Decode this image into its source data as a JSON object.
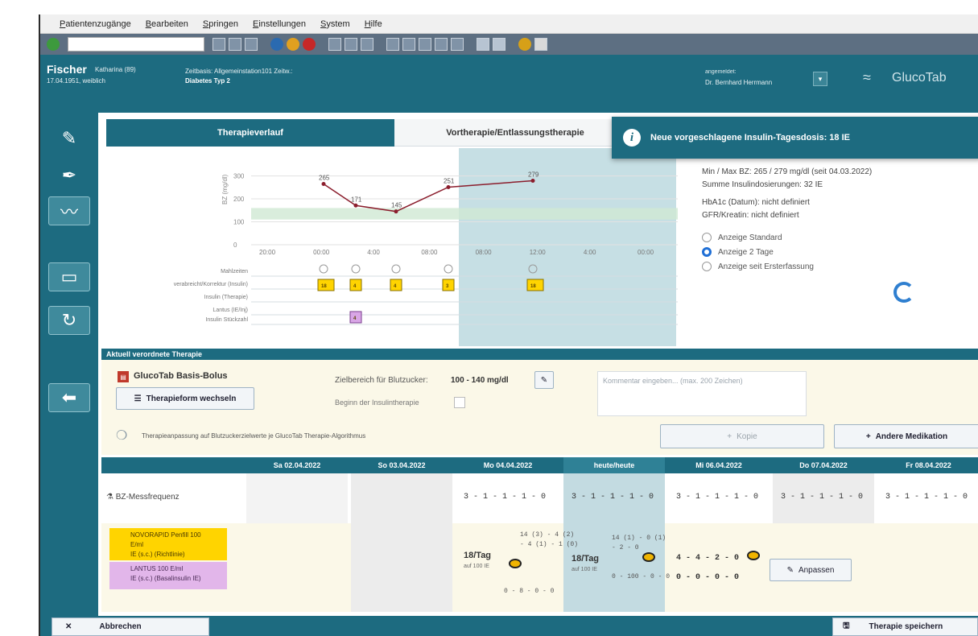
{
  "menu": [
    "Patientenzugänge",
    "Bearbeiten",
    "Springen",
    "Einstellungen",
    "System",
    "Hilfe"
  ],
  "toolbar": {
    "address_value": ""
  },
  "header": {
    "patient_name": "Fischer",
    "patient_first": "Katharina (89)",
    "patient_date": "17.04.1951, weiblich",
    "patient_info": "Zeitbasis: Allgemeinstation101 Zeitw.:",
    "diagnosis": "Diabetes Typ 2",
    "login_label": "angemeldet:",
    "login_user": "Dr. Bernhard Herrmann",
    "brand": "GlucoTab"
  },
  "tabs": [
    "Therapieverlauf",
    "Vortherapie/Entlassungstherapie"
  ],
  "popup": {
    "text": "Neue vorgeschlagene Insulin-Tagesdosis: 18 IE"
  },
  "chart_data": {
    "type": "line",
    "ylabel": "BZ (mg/dl)",
    "ylim": [
      0,
      400
    ],
    "yticks": [
      "300",
      "200",
      "100",
      "0"
    ],
    "x_ticks": [
      "20:00",
      "00:00",
      "4:00",
      "08:00",
      "08:00",
      "12:00",
      "4:00",
      "00:00"
    ],
    "series": [
      {
        "values": [
          265,
          171,
          145,
          251,
          279
        ]
      }
    ],
    "labels": [
      "265",
      "171",
      "145",
      "251",
      "279"
    ],
    "target_band": [
      110,
      160
    ],
    "rows": [
      {
        "label": "Mahlzeiten",
        "events": [
          "",
          "",
          "",
          "",
          ""
        ]
      },
      {
        "label": "verabreicht/Korrektur (Insulin)",
        "events": [
          "18",
          "4",
          "4",
          "3",
          "18"
        ]
      },
      {
        "label": "Insulin (Therapie)",
        "events": []
      },
      {
        "label": "Lantus (IE/Inj)",
        "events": [
          "4"
        ]
      },
      {
        "label": "Insulin Stückzahl",
        "events": []
      }
    ]
  },
  "info": {
    "line1": "Min / Max BZ: 265 / 279 mg/dl (seit 04.03.2022)",
    "line2": "Summe Insulindosierungen: 32 IE",
    "line3": "HbA1c (Datum): nicht definiert",
    "line4": "GFR/Kreatin: nicht definiert",
    "radio1": "Anzeige Standard",
    "radio2": "Anzeige 2 Tage",
    "radio3": "Anzeige seit Ersterfassung"
  },
  "therapy": {
    "section_title": "Aktuell verordnete Therapie",
    "scheme": "GlucoTab Basis-Bolus",
    "change_button": "Therapieform wechseln",
    "target_label": "Zielbereich für Blutzucker:",
    "target_value": "100 - 140 mg/dl",
    "insulin_label": "Beginn der Insulintherapie",
    "comment_placeholder": "Kommentar eingeben... (max. 200 Zeichen)",
    "hint": "Therapieanpassung auf Blutzuckerzielwerte je GlucoTab Therapie-Algorithmus",
    "btn_mid": "Kopie",
    "btn_other": "Andere Medikation"
  },
  "table": {
    "headers": [
      "Sa 02.04.2022",
      "So 03.04.2022",
      "Mo 04.04.2022",
      "heute/heute",
      "Mi 06.04.2022",
      "Do 07.04.2022",
      "Fr 08.04.2022"
    ],
    "row1_label": "BZ-Messfrequenz",
    "row1_values": [
      "",
      "",
      "3 - 1 - 1 - 1 - 0",
      "3 - 1 - 1 - 1 - 0",
      "3 - 1 - 1 - 1 - 0",
      "3 - 1 - 1 - 1 - 0",
      "3 - 1 - 1 - 1 - 0"
    ],
    "med1": [
      "NOVORAPID Penfill 100",
      "E/ml",
      "IE (s.c.) (Richtlinie)"
    ],
    "med2": [
      "LANTUS 100 E/ml",
      "IE (s.c.) (Basalinsulin IE)"
    ],
    "day3_dose": "18/Tag",
    "day3_sub": "auf 100 IE",
    "day3_scheme": "14 (3) - 4 (2)",
    "day3_scheme2": "- 4 (1) - 1 (0)",
    "day3_bottom": "0 - 8 - 0 - 0",
    "day4_dose": "18/Tag",
    "day4_sub": "auf 100 IE",
    "day4_scheme": "14 (1) - 0 (1)",
    "day4_scheme2": "- 2 - 0",
    "day4_bottom": "0 - 100 - 0 - 0",
    "day5_line1": "4 - 4 - 2 - 0",
    "day5_line2": "0 - 0 - 0 - 0",
    "adjust": "Anpassen"
  },
  "footer": {
    "cancel": "Abbrechen",
    "save": "Therapie speichern"
  }
}
